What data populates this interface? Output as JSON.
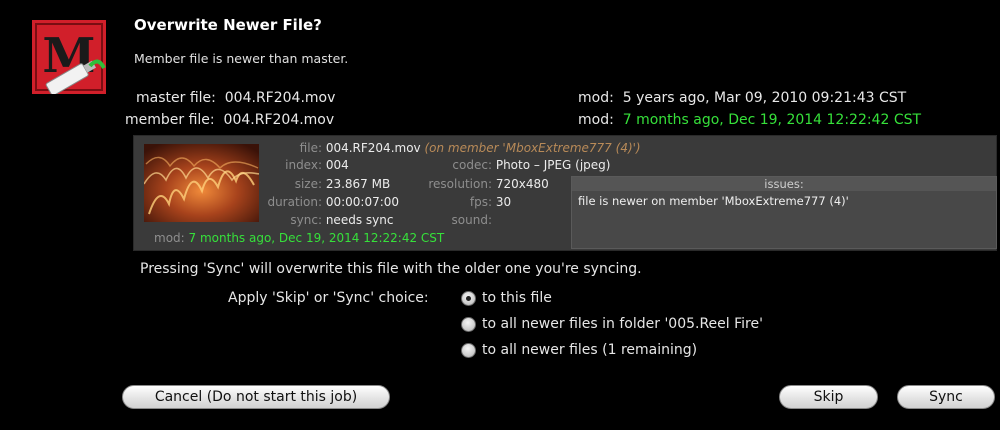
{
  "dialog": {
    "title": "Overwrite Newer File?",
    "subtitle": "Member file is newer than master."
  },
  "files": {
    "master_label": "master file:",
    "master_name": "004.RF204.mov",
    "master_mod_label": "mod:",
    "master_mod_value": "5 years ago, Mar 09, 2010 09:21:43 CST",
    "member_label": "member file:",
    "member_name": "004.RF204.mov",
    "member_mod_label": "mod:",
    "member_mod_value": "7 months ago, Dec 19, 2014 12:22:42 CST"
  },
  "panel": {
    "file_label": "file:",
    "file_value": "004.RF204.mov",
    "file_note": "(on member 'MboxExtreme777 (4)')",
    "index_label": "index:",
    "index_value": "004",
    "size_label": "size:",
    "size_value": "23.867 MB",
    "duration_label": "duration:",
    "duration_value": "00:00:07:00",
    "sync_label": "sync:",
    "sync_value": "needs sync",
    "codec_label": "codec:",
    "codec_value": "Photo – JPEG (jpeg)",
    "resolution_label": "resolution:",
    "resolution_value": "720x480",
    "fps_label": "fps:",
    "fps_value": "30",
    "sound_label": "sound:",
    "sound_value": "",
    "mod_label": "mod:",
    "mod_value": "7 months ago, Dec 19, 2014 12:22:42 CST",
    "issues_header": "issues:",
    "issues_text": "file is newer on member 'MboxExtreme777 (4)'"
  },
  "message": "Pressing 'Sync' will overwrite this file with the older one you're syncing.",
  "apply": {
    "label": "Apply 'Skip' or 'Sync' choice:",
    "options": [
      {
        "label": "to this file",
        "selected": true
      },
      {
        "label": "to all newer files in folder '005.Reel Fire'",
        "selected": false
      },
      {
        "label": "to all newer files (1 remaining)",
        "selected": false
      }
    ]
  },
  "buttons": {
    "cancel": "Cancel (Do not start this job)",
    "skip": "Skip",
    "sync": "Sync"
  },
  "colors": {
    "accent_green": "#36e03a",
    "note_orange": "#b88a58",
    "icon_red": "#d11f2a"
  },
  "icons": {
    "app_icon": "mbox-app-icon",
    "thumbnail": "fire-thumbnail"
  }
}
